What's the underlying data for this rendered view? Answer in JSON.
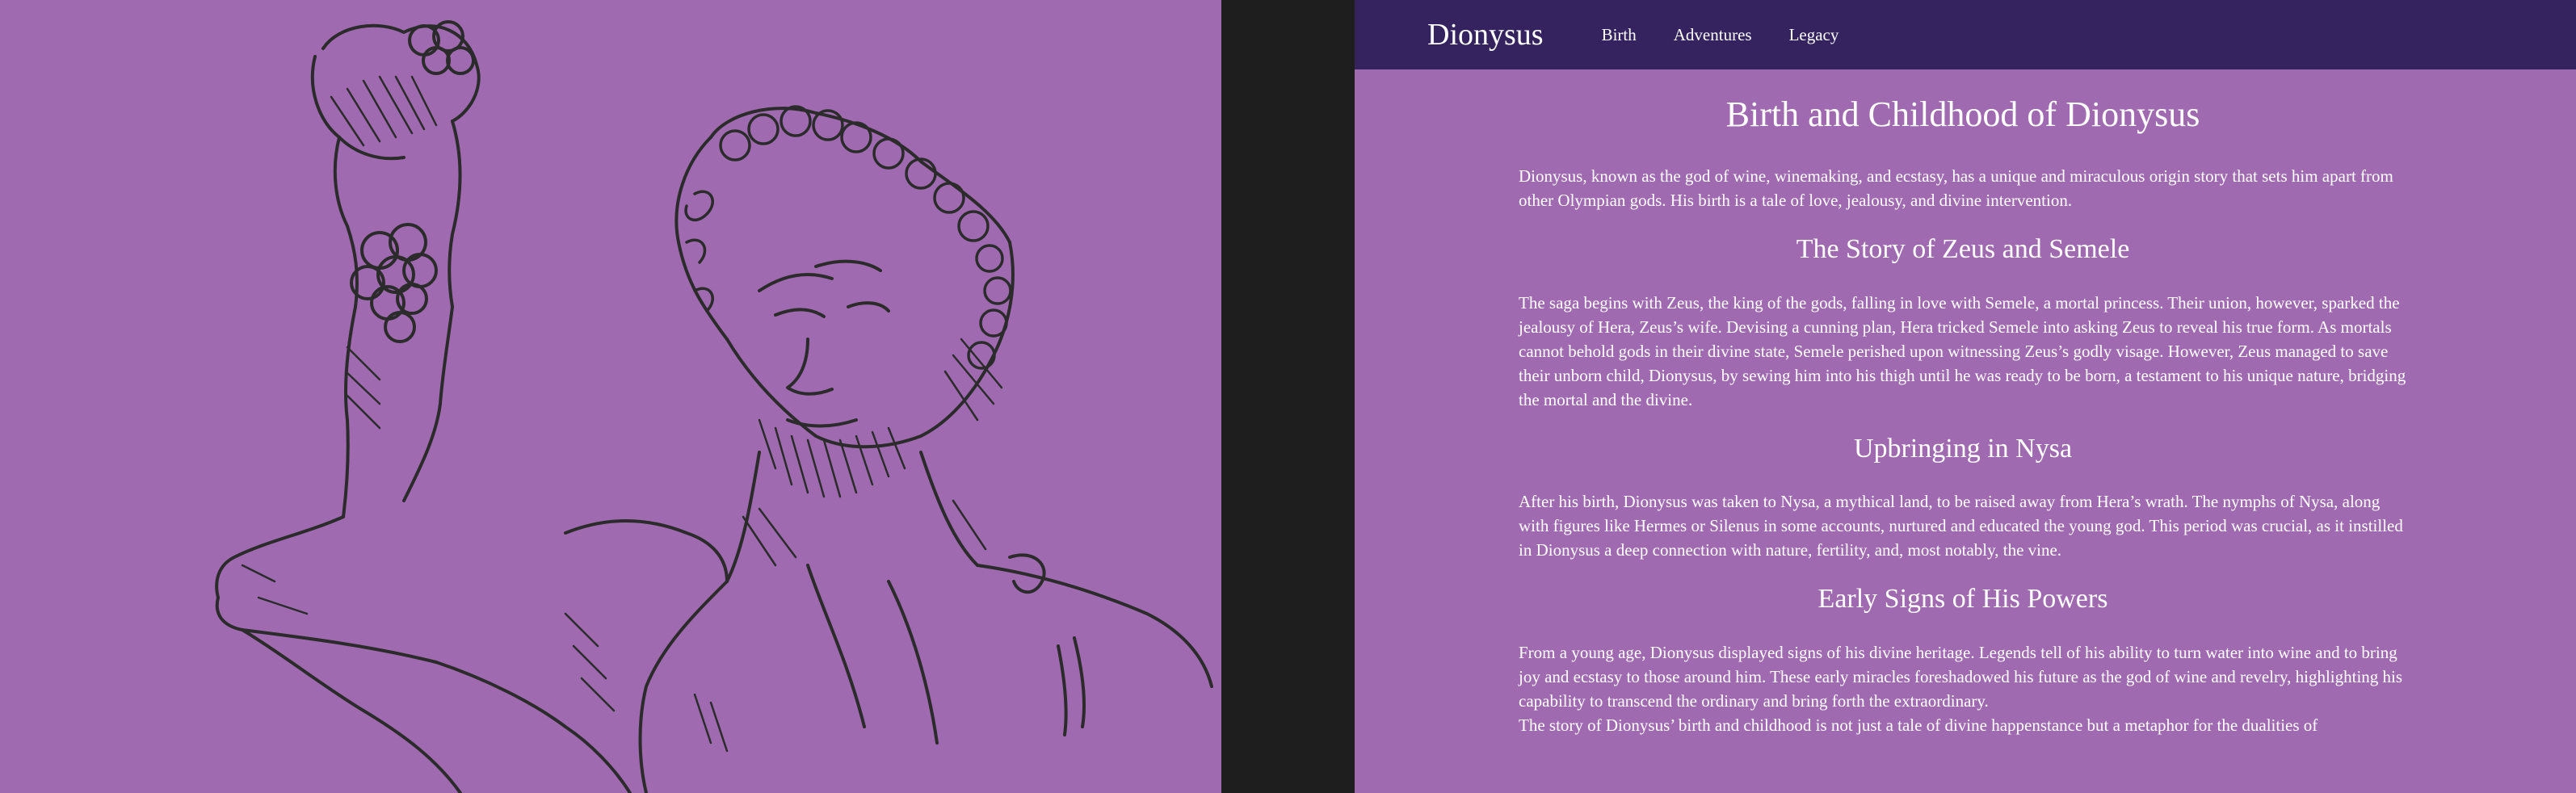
{
  "artwork": {
    "description_icon": "dionysus-statue-sketch"
  },
  "navbar": {
    "brand": "Dionysus",
    "links": [
      "Birth",
      "Adventures",
      "Legacy"
    ]
  },
  "article": {
    "title": "Birth and Childhood of Dionysus",
    "intro": "Dionysus, known as the god of wine, winemaking, and ecstasy, has a unique and miraculous origin story that sets him apart from other Olympian gods. His birth is a tale of love, jealousy, and divine intervention.",
    "sections": [
      {
        "heading": "The Story of Zeus and Semele",
        "body": "The saga begins with Zeus, the king of the gods, falling in love with Semele, a mortal princess. Their union, however, sparked the jealousy of Hera, Zeus’s wife. Devising a cunning plan, Hera tricked Semele into asking Zeus to reveal his true form. As mortals cannot behold gods in their divine state, Semele perished upon witnessing Zeus’s godly visage. However, Zeus managed to save their unborn child, Dionysus, by sewing him into his thigh until he was ready to be born, a testament to his unique nature, bridging the mortal and the divine."
      },
      {
        "heading": "Upbringing in Nysa",
        "body": "After his birth, Dionysus was taken to Nysa, a mythical land, to be raised away from Hera’s wrath. The nymphs of Nysa, along with figures like Hermes or Silenus in some accounts, nurtured and educated the young god. This period was crucial, as it instilled in Dionysus a deep connection with nature, fertility, and, most notably, the vine."
      },
      {
        "heading": "Early Signs of His Powers",
        "body": "From a young age, Dionysus displayed signs of his divine heritage. Legends tell of his ability to turn water into wine and to bring joy and ecstasy to those around him. These early miracles foreshadowed his future as the god of wine and revelry, highlighting his capability to transcend the ordinary and bring forth the extraordinary."
      }
    ],
    "closing": "The story of Dionysus’ birth and childhood is not just a tale of divine happenstance but a metaphor for the dualities of"
  },
  "colors": {
    "background": "#a06ab1",
    "navbar": "#34235f",
    "divider": "#1e1e1e",
    "ink": "#2b2b2b",
    "text": "#ffffff"
  }
}
